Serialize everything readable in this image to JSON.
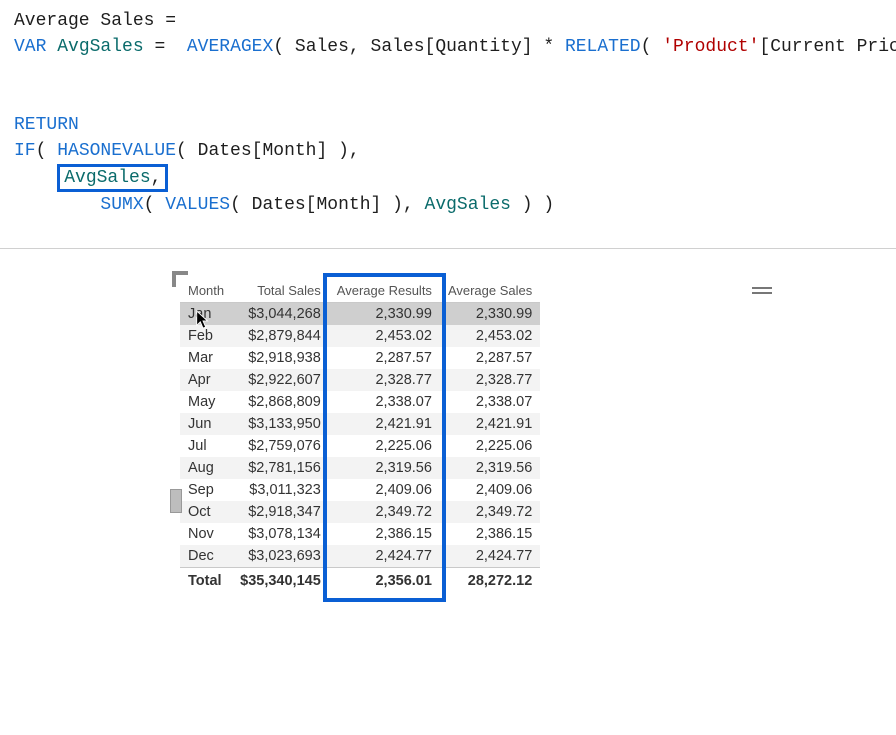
{
  "dax": {
    "measure_name": "Average Sales",
    "var_name": "AvgSales",
    "averagex_table": "Sales",
    "quantity_col": "Sales[Quantity]",
    "product_str": "'Product'",
    "price_col": "[Current Price]",
    "dates_month": "Dates[Month]",
    "kw_var": "VAR",
    "kw_averagex": "AVERAGEX",
    "kw_related": "RELATED",
    "kw_return": "RETURN",
    "kw_if": "IF",
    "kw_hasonevalue": "HASONEVALUE",
    "kw_sumx": "SUMX",
    "kw_values": "VALUES"
  },
  "table": {
    "headers": {
      "month": "Month",
      "total_sales": "Total Sales",
      "avg_results": "Average Results",
      "avg_sales": "Average Sales"
    },
    "rows": [
      {
        "m": "Jan",
        "ts": "$3,044,268",
        "ar": "2,330.99",
        "as": "2,330.99"
      },
      {
        "m": "Feb",
        "ts": "$2,879,844",
        "ar": "2,453.02",
        "as": "2,453.02"
      },
      {
        "m": "Mar",
        "ts": "$2,918,938",
        "ar": "2,287.57",
        "as": "2,287.57"
      },
      {
        "m": "Apr",
        "ts": "$2,922,607",
        "ar": "2,328.77",
        "as": "2,328.77"
      },
      {
        "m": "May",
        "ts": "$2,868,809",
        "ar": "2,338.07",
        "as": "2,338.07"
      },
      {
        "m": "Jun",
        "ts": "$3,133,950",
        "ar": "2,421.91",
        "as": "2,421.91"
      },
      {
        "m": "Jul",
        "ts": "$2,759,076",
        "ar": "2,225.06",
        "as": "2,225.06"
      },
      {
        "m": "Aug",
        "ts": "$2,781,156",
        "ar": "2,319.56",
        "as": "2,319.56"
      },
      {
        "m": "Sep",
        "ts": "$3,011,323",
        "ar": "2,409.06",
        "as": "2,409.06"
      },
      {
        "m": "Oct",
        "ts": "$2,918,347",
        "ar": "2,349.72",
        "as": "2,349.72"
      },
      {
        "m": "Nov",
        "ts": "$3,078,134",
        "ar": "2,386.15",
        "as": "2,386.15"
      },
      {
        "m": "Dec",
        "ts": "$3,023,693",
        "ar": "2,424.77",
        "as": "2,424.77"
      }
    ],
    "totals": {
      "label": "Total",
      "ts": "$35,340,145",
      "ar": "2,356.01",
      "as": "28,272.12"
    }
  }
}
